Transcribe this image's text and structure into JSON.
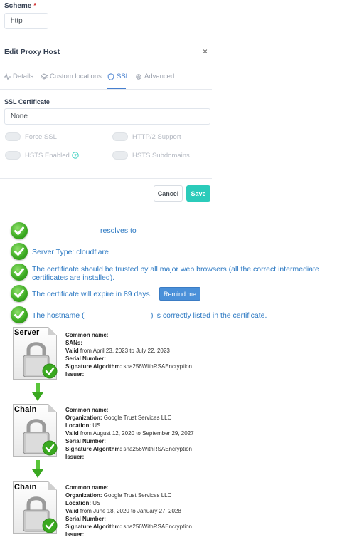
{
  "scheme": {
    "label": "Scheme",
    "required_mark": "*",
    "value": "http"
  },
  "modal": {
    "title": "Edit Proxy Host",
    "close": "×",
    "tabs": [
      {
        "label": "Details",
        "icon": "pulse-icon"
      },
      {
        "label": "Custom locations",
        "icon": "layers-icon"
      },
      {
        "label": "SSL",
        "icon": "shield-icon",
        "active": true
      },
      {
        "label": "Advanced",
        "icon": "gear-icon"
      }
    ],
    "ssl_cert_label": "SSL Certificate",
    "ssl_cert_value": "None",
    "toggles": [
      {
        "label": "Force SSL"
      },
      {
        "label": "HTTP/2 Support"
      },
      {
        "label": "HSTS Enabled"
      },
      {
        "label": "HSTS Subdomains"
      }
    ],
    "cancel": "Cancel",
    "save": "Save"
  },
  "checker": {
    "results": [
      "resolves to",
      "Server Type: cloudflare",
      "The certificate should be trusted by all major web browsers (all the correct intermediate certificates are installed).",
      "The certificate will expire in 89 days.",
      "The hostname (",
      ") is correctly listed in the certificate."
    ],
    "remind_button": "Remind me",
    "certs": [
      {
        "tag": "Server",
        "lines": [
          {
            "k": "Common name:",
            "v": ""
          },
          {
            "k": "SANs:",
            "v": ""
          },
          {
            "k": "Valid",
            "v": "from April 23, 2023 to July 22, 2023"
          },
          {
            "k": "Serial Number:",
            "v": ""
          },
          {
            "k": "Signature Algorithm:",
            "v": "sha256WithRSAEncryption"
          },
          {
            "k": "Issuer:",
            "v": ""
          }
        ]
      },
      {
        "tag": "Chain",
        "lines": [
          {
            "k": "Common name:",
            "v": ""
          },
          {
            "k": "Organization:",
            "v": "Google Trust Services LLC"
          },
          {
            "k": "Location:",
            "v": "US"
          },
          {
            "k": "Valid",
            "v": "from August 12, 2020 to September 29, 2027"
          },
          {
            "k": "Serial Number:",
            "v": ""
          },
          {
            "k": "Signature Algorithm:",
            "v": "sha256WithRSAEncryption"
          },
          {
            "k": "Issuer:",
            "v": ""
          }
        ]
      },
      {
        "tag": "Chain",
        "lines": [
          {
            "k": "Common name:",
            "v": ""
          },
          {
            "k": "Organization:",
            "v": "Google Trust Services LLC"
          },
          {
            "k": "Location:",
            "v": "US"
          },
          {
            "k": "Valid",
            "v": "from June 18, 2020 to January 27, 2028"
          },
          {
            "k": "Serial Number:",
            "v": ""
          },
          {
            "k": "Signature Algorithm:",
            "v": "sha256WithRSAEncryption"
          },
          {
            "k": "Issuer:",
            "v": ""
          }
        ]
      }
    ]
  }
}
